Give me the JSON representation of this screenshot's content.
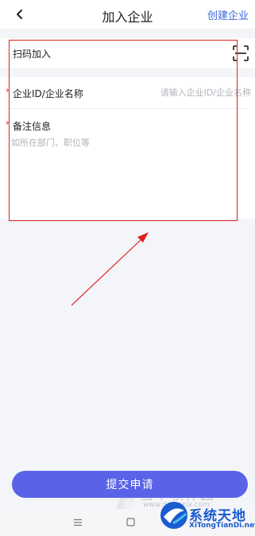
{
  "header": {
    "title": "加入企业",
    "create_label": "创建企业"
  },
  "scan": {
    "label": "扫码加入"
  },
  "form": {
    "required_mark": "*",
    "id_label": "企业ID/企业名称",
    "id_placeholder": "请输入企业ID/企业名称",
    "note_label": "备注信息",
    "note_placeholder": "如所在部门、职位等"
  },
  "submit_label": "提交申请",
  "watermarks": {
    "site1_name": "当下软件园",
    "site1_url": "www.downxia.com",
    "site2_name": "系统天地",
    "site2_url": "XiTongTianDi.net"
  },
  "colors": {
    "accent": "#5a63e8",
    "link": "#3a66d6",
    "required": "#e0442f",
    "annotation": "#e02020"
  }
}
